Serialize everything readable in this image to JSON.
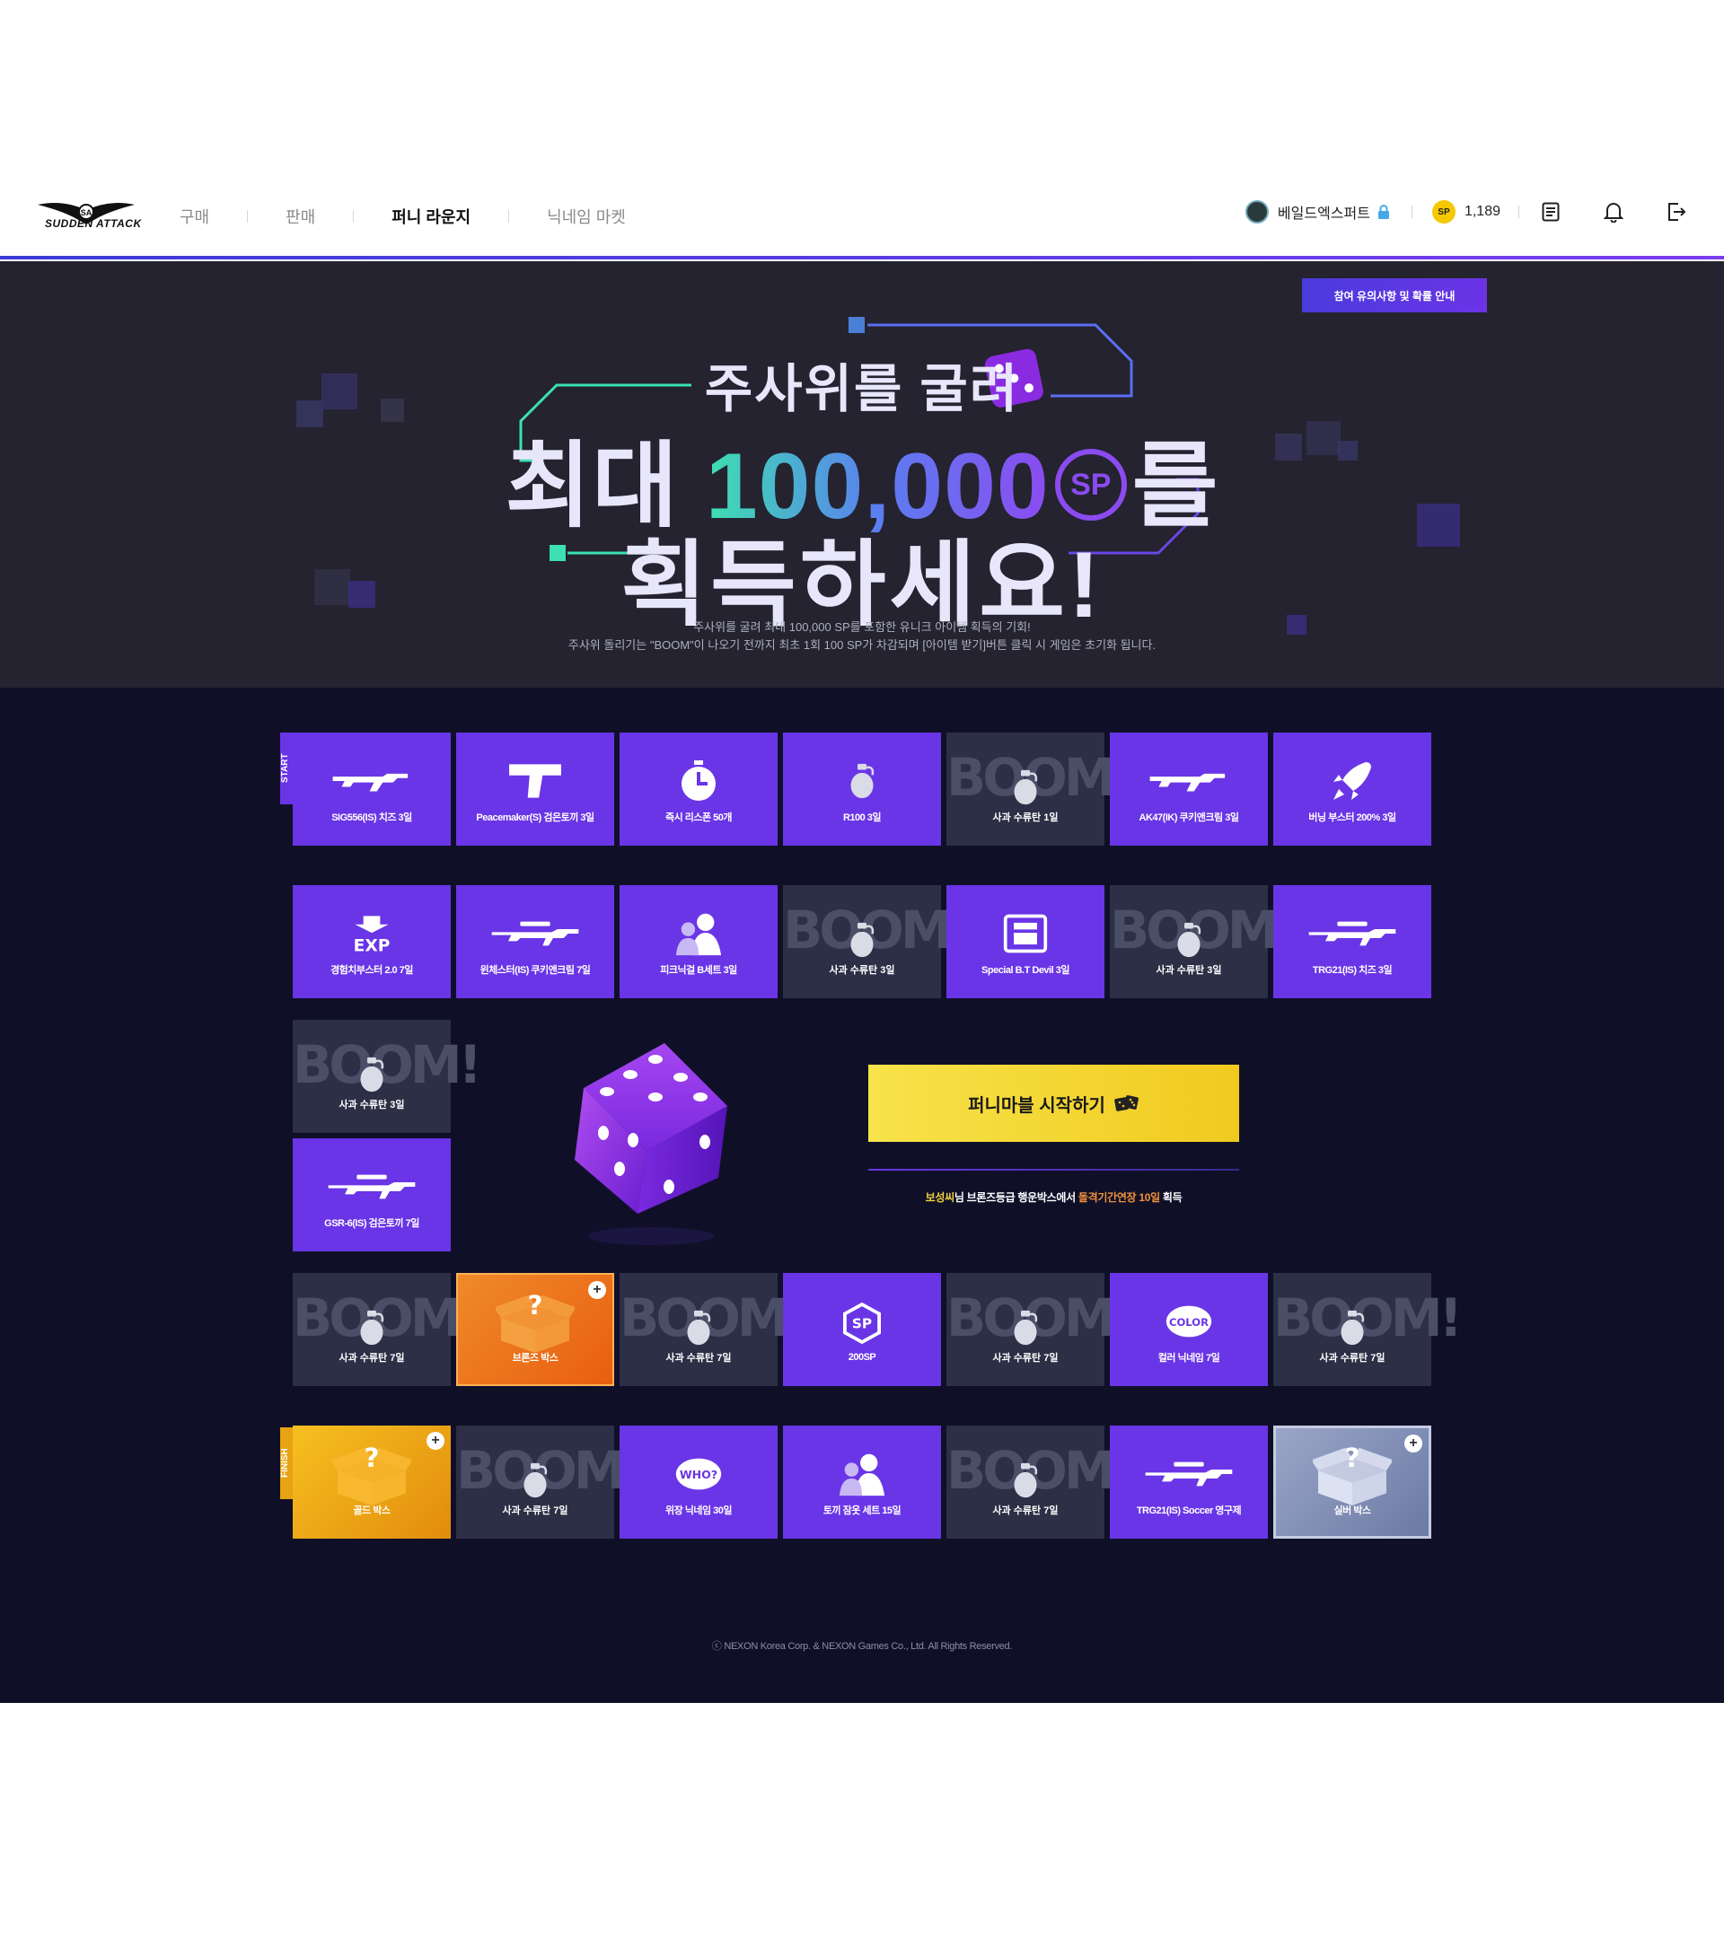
{
  "header": {
    "logo_text": "SUDDEN ATTACK",
    "nav": [
      "구매",
      "판매",
      "퍼니 라운지",
      "닉네임 마켓"
    ],
    "active_nav_index": 2,
    "username": "베일드엑스퍼트",
    "sp_badge": "SP",
    "sp_amount": "1,189",
    "accent_color": "#6a35e6"
  },
  "hero": {
    "notice_button": "참여 유의사항 및 확률 안내",
    "line1": "주사위를 굴려",
    "line2_prefix": "최대 ",
    "line2_number": "100,000",
    "line2_sp": "SP",
    "line2_suffix": "를",
    "line3": "획득하세요!",
    "desc1": "주사위를 굴려 최대 100,000 SP를 포함한 유니크 아이템 획득의 기회!",
    "desc2": "주사위 돌리기는 \"BOOM\"이 나오기 전까지 최초 1회 100 SP가 차감되며 [아이템 받기]버튼 클릭 시 게임은 초기화 됩니다."
  },
  "board": {
    "start_tag": "START",
    "finish_tag": "FINISH",
    "boom_word": "BOOM!",
    "row1": [
      {
        "label": "SIG556(IS) 치즈 3일",
        "type": "item",
        "icon": "rifle-icon"
      },
      {
        "label": "Peacemaker(S) 검은토끼 3일",
        "type": "item",
        "icon": "pistol-icon"
      },
      {
        "label": "즉시 리스폰 50개",
        "type": "item",
        "icon": "stopwatch-icon"
      },
      {
        "label": "R100 3일",
        "type": "item",
        "icon": "grenade-icon"
      },
      {
        "label": "사과 수류탄 1일",
        "type": "boom",
        "icon": "grenade-icon"
      },
      {
        "label": "AK47(IK) 쿠키앤크림 3일",
        "type": "item",
        "icon": "rifle-icon"
      },
      {
        "label": "버닝 부스터 200% 3일",
        "type": "item",
        "icon": "rocket-icon"
      }
    ],
    "row2": [
      {
        "label": "경험치부스터 2.0 7일",
        "type": "item",
        "icon": "exp-icon"
      },
      {
        "label": "윈체스터(IS) 쿠키앤크림 7일",
        "type": "item",
        "icon": "sniper-icon"
      },
      {
        "label": "피크닉걸 B세트 3일",
        "type": "item",
        "icon": "character-icon"
      },
      {
        "label": "사과 수류탄 3일",
        "type": "boom",
        "icon": "grenade-icon"
      },
      {
        "label": "Special B.T Devil 3일",
        "type": "item",
        "icon": "device-icon"
      },
      {
        "label": "사과 수류탄 3일",
        "type": "boom",
        "icon": "grenade-icon"
      },
      {
        "label": "TRG21(IS) 치즈 3일",
        "type": "item",
        "icon": "sniper-icon"
      }
    ],
    "col_left": [
      {
        "label": "사과 수류탄 3일",
        "type": "boom",
        "icon": "grenade-icon"
      },
      {
        "label": "GSR-6(IS) 검은토끼 7일",
        "type": "item",
        "icon": "sniper-icon"
      }
    ],
    "row3": [
      {
        "label": "사과 수류탄 7일",
        "type": "boom",
        "icon": "grenade-icon"
      },
      {
        "label": "브론즈 박스",
        "type": "bronze",
        "icon": "mystery-box-icon"
      },
      {
        "label": "사과 수류탄 7일",
        "type": "boom",
        "icon": "grenade-icon"
      },
      {
        "label": "200SP",
        "type": "item",
        "icon": "sp-icon"
      },
      {
        "label": "사과 수류탄 7일",
        "type": "boom",
        "icon": "grenade-icon"
      },
      {
        "label": "컬러 닉네임 7일",
        "type": "item",
        "icon": "color-icon"
      },
      {
        "label": "사과 수류탄 7일",
        "type": "boom",
        "icon": "grenade-icon"
      }
    ],
    "row4": [
      {
        "label": "골드 박스",
        "type": "gold",
        "icon": "mystery-box-icon"
      },
      {
        "label": "사과 수류탄 7일",
        "type": "boom",
        "icon": "grenade-icon"
      },
      {
        "label": "위장 닉네임 30일",
        "type": "item",
        "icon": "who-icon"
      },
      {
        "label": "토끼 잠옷 세트 15일",
        "type": "item",
        "icon": "character-icon"
      },
      {
        "label": "사과 수류탄 7일",
        "type": "boom",
        "icon": "grenade-icon"
      },
      {
        "label": "TRG21(IS) Soccer 영구제",
        "type": "item",
        "icon": "sniper-icon"
      },
      {
        "label": "실버 박스",
        "type": "silver",
        "icon": "mystery-box-icon"
      }
    ],
    "start_button": "퍼니마블 시작하기",
    "reward_prefix": "보성씨",
    "reward_mid1": "님 브론즈등급 행운박스에서 ",
    "reward_highlight": "돌격기간연장 10일",
    "reward_suffix": " 획득"
  },
  "footer": {
    "copyright": "ⓒ NEXON Korea Corp. & NEXON Games Co., Ltd. All Rights Reserved."
  }
}
